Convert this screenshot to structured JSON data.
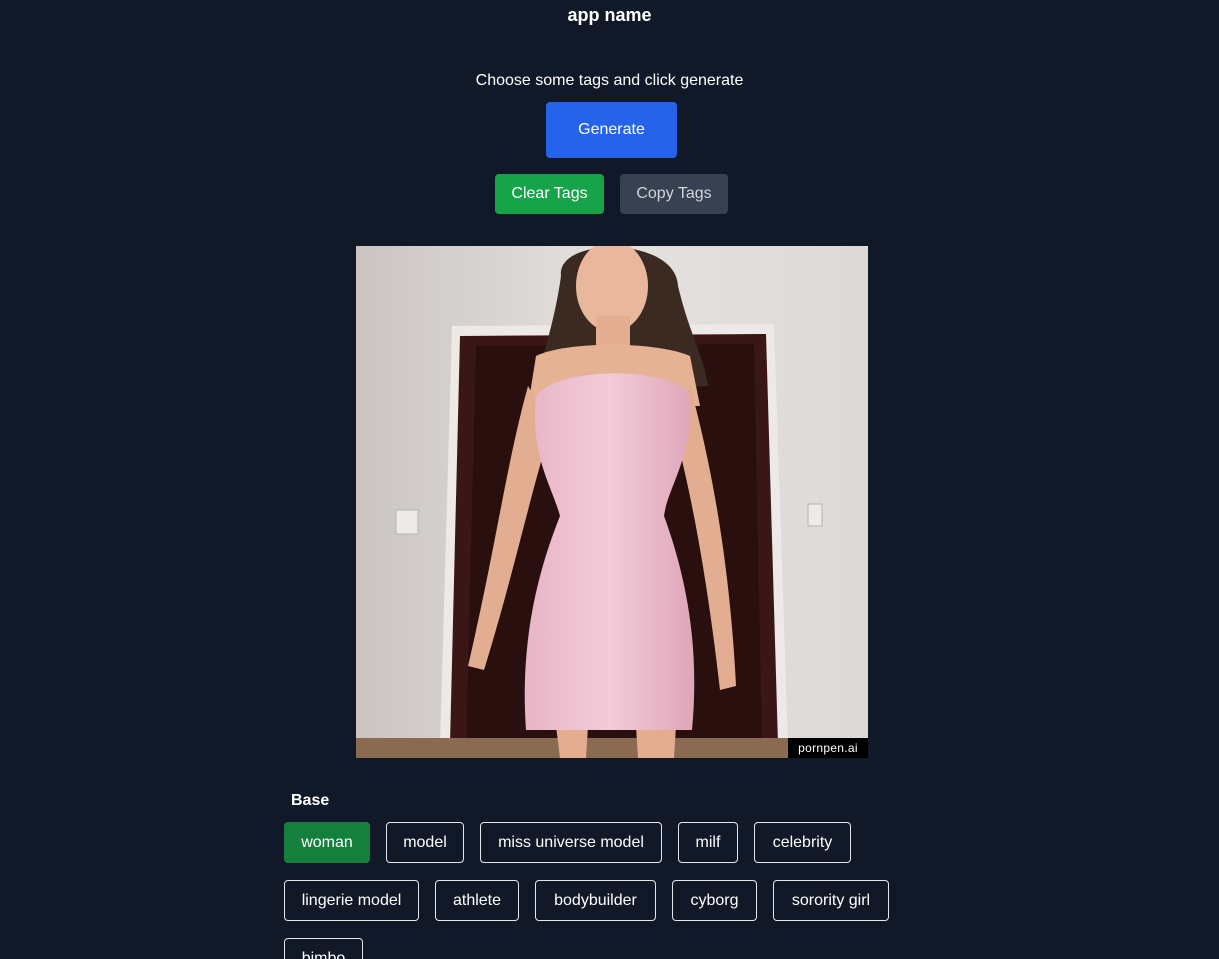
{
  "header": {
    "app_name": "app name",
    "subtitle": "Choose some tags and click generate"
  },
  "actions": {
    "generate_label": "Generate",
    "clear_tags_label": "Clear Tags",
    "copy_tags_label": "Copy Tags"
  },
  "preview": {
    "watermark": "pornpen.ai"
  },
  "sections": [
    {
      "title": "Base",
      "tags": [
        {
          "label": "woman",
          "selected": true
        },
        {
          "label": "model",
          "selected": false
        },
        {
          "label": "miss universe model",
          "selected": false
        },
        {
          "label": "milf",
          "selected": false
        },
        {
          "label": "celebrity",
          "selected": false
        },
        {
          "label": "lingerie model",
          "selected": false
        },
        {
          "label": "athlete",
          "selected": false
        },
        {
          "label": "bodybuilder",
          "selected": false
        },
        {
          "label": "cyborg",
          "selected": false
        },
        {
          "label": "sorority girl",
          "selected": false
        },
        {
          "label": "bimbo",
          "selected": false
        }
      ]
    }
  ],
  "colors": {
    "background": "#111827",
    "generate": "#2563eb",
    "clear": "#16a34a",
    "copy": "#374151",
    "tag_selected": "#15803d"
  }
}
